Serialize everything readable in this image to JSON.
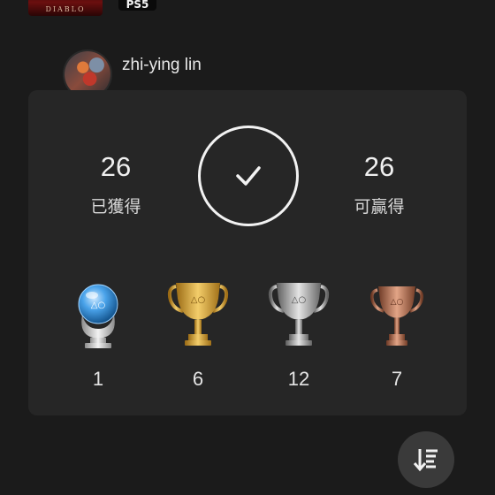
{
  "game": {
    "thumbnail_text": "DIABLO",
    "platform": "PS5"
  },
  "user": {
    "name": "zhi-ying lin"
  },
  "summary": {
    "earned_count": "26",
    "earned_label": "已獲得",
    "total_count": "26",
    "total_label": "可贏得"
  },
  "trophies": [
    {
      "type": "platinum",
      "icon": "platinum-trophy-icon",
      "count": "1"
    },
    {
      "type": "gold",
      "icon": "gold-trophy-icon",
      "count": "6"
    },
    {
      "type": "silver",
      "icon": "silver-trophy-icon",
      "count": "12"
    },
    {
      "type": "bronze",
      "icon": "bronze-trophy-icon",
      "count": "7"
    }
  ],
  "colors": {
    "background": "#1b1b1b",
    "card": "#262626",
    "gold": "#d9a63a",
    "silver": "#b8b8b8",
    "bronze": "#b8745a",
    "platinum": "#4aa3ea"
  },
  "icons": {
    "complete": "checkmark-icon",
    "sort": "sort-icon"
  }
}
